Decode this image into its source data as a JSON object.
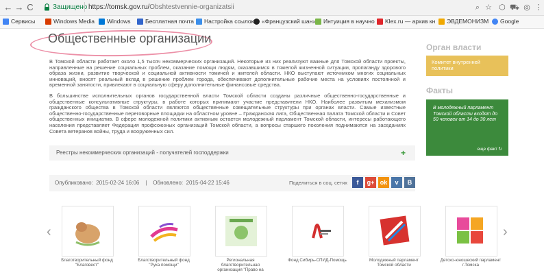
{
  "browser": {
    "secure_label": "Защищено",
    "url_host": "https://tomsk.gov.ru/",
    "url_path": "Obshtestvennie-organizatsii",
    "nav_back": "←",
    "nav_forward": "→",
    "nav_reload": "C",
    "nav_home": "⌂",
    "toolbar_icons": [
      "⌕",
      "☆",
      "⬡",
      "⛟",
      "◎",
      "⋮"
    ]
  },
  "bookmarks": [
    {
      "label": "Сервисы",
      "color": "#4285f4"
    },
    {
      "label": "Windows Media",
      "color": "#d83b01"
    },
    {
      "label": "Windows",
      "color": "#0078d7"
    },
    {
      "label": "Бесплатная почта",
      "color": "#3366cc"
    },
    {
      "label": "Настройка ссылок",
      "color": "#3b8eea"
    },
    {
      "label": "«Французский шан»",
      "color": "#222222"
    },
    {
      "label": "Интуиция в научно",
      "color": "#7ab648"
    },
    {
      "label": "Klex.ru — архив кн",
      "color": "#e0262b"
    },
    {
      "label": "ЭВДЕМОНИЗМ",
      "color": "#f0a800"
    },
    {
      "label": "Google",
      "color": "#4285f4"
    }
  ],
  "page": {
    "title": "Общественные организации",
    "paragraph1": "В Томской области работает около 1,5 тысяч некоммерческих организаций. Некоторые из них реализуют важные для Томской области проекты, направленные на решение социальных проблем, оказание помощи людям, оказавшимся в тяжелой жизненной ситуации, пропаганду здорового образа жизни, развитие творческой и социальной активности томичей и жителей области. НКО выступают источником многих социальных инноваций, вносят реальный вклад в решение проблем города, обеспечивают дополнительные рабочие места на условиях постоянной и временной занятости, привлекают в социальную сферу дополнительные финансовые средства.",
    "paragraph2": "В большинстве исполнительных органов государственной власти Томской области созданы различные общественно-государственные и общественные консультативные структуры, в работе которых принимают участие представители НКО. Наиболее развитым механизмом гражданского общества в Томской области являются общественные совещательные структуры при органах власти. Самые известные общественно-государственные переговорные площадки на областном уровне – Гражданская лига, Общественная палата Томской области и Совет общественных инициатив. В сфере молодежной политики активным остается молодежный парламент Томской области, интересы работающего населения представляет Федерация профсоюзных организаций Томской области, а вопросы старшего поколения поднимаются на заседаниях Совета ветеранов войны, труда и вооруженных сил.",
    "accordion_label": "Реестры некоммерческих организаций - получателей господдержки",
    "accordion_plus": "+",
    "published": "Опубликовано:  2015-02-24 16:06    |    Обновлено:  2015-04-22 15:46",
    "share_label": "Поделиться в соц. сетях",
    "share_buttons": [
      {
        "glyph": "f",
        "color": "#3b5998"
      },
      {
        "glyph": "g+",
        "color": "#dd4b39"
      },
      {
        "glyph": "ok",
        "color": "#f2930f"
      },
      {
        "glyph": "v",
        "color": "#4a76a8"
      },
      {
        "glyph": "В",
        "color": "#507299"
      }
    ]
  },
  "sidebar": {
    "authority_heading": "Орган власти",
    "authority_link": "Комитет внутренней политики",
    "facts_heading": "Факты",
    "fact_text": "В молодежный парламент Томской области входят до 50 человек от 14 до 30 лет",
    "fact_more": "еще факт"
  },
  "carousel": {
    "prev": "‹",
    "next": "›",
    "items": [
      {
        "caption": "Благотворительный фонд \"Благовест\""
      },
      {
        "caption": "Благотворительный фонд \"Рука помощи\""
      },
      {
        "caption": "Региональная благотворительная организация \"Право на"
      },
      {
        "caption": "Фонд Сибирь-СПИД-Помощь"
      },
      {
        "caption": "Молодежный парламент Томской области"
      },
      {
        "caption": "Детско-юношеский парламент г.Томска"
      }
    ]
  }
}
